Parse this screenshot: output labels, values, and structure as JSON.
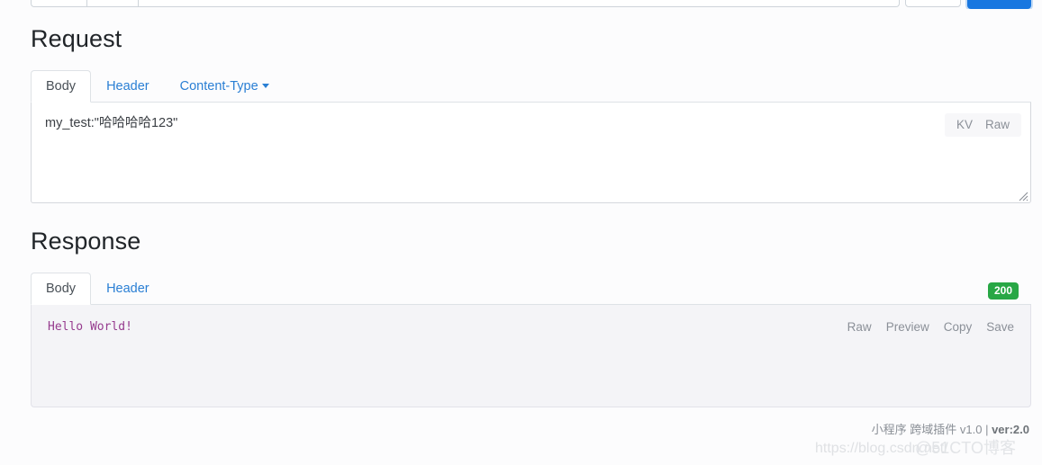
{
  "top_form": {
    "send_button_label": "",
    "segments": [
      "",
      "",
      "",
      ""
    ]
  },
  "request": {
    "title": "Request",
    "tabs": [
      {
        "label": "Body",
        "active": true
      },
      {
        "label": "Header",
        "active": false
      },
      {
        "label": "Content-Type",
        "active": false,
        "has_caret": true
      }
    ],
    "body_value": "my_test:\"哈哈哈哈123\"",
    "body_placeholder": "",
    "view_toggle": [
      "KV",
      "Raw"
    ]
  },
  "response": {
    "title": "Response",
    "tabs": [
      {
        "label": "Body",
        "active": true
      },
      {
        "label": "Header",
        "active": false
      }
    ],
    "status_code": "200",
    "status_color": "#28a745",
    "body_value": "Hello World!",
    "body_text_color": "#963b8e",
    "actions": [
      "Raw",
      "Preview",
      "Copy",
      "Save"
    ]
  },
  "footer": {
    "product": "小程序 跨域插件 v1.0 | ",
    "version": "ver:2.0"
  },
  "watermarks": {
    "csdn": "https://blog.csdn.net/",
    "cto": "@51CTO博客"
  },
  "colors": {
    "accent": "#1877e0",
    "link": "#2a7fd4",
    "success": "#28a745",
    "page_bg": "#fcfcfd"
  }
}
